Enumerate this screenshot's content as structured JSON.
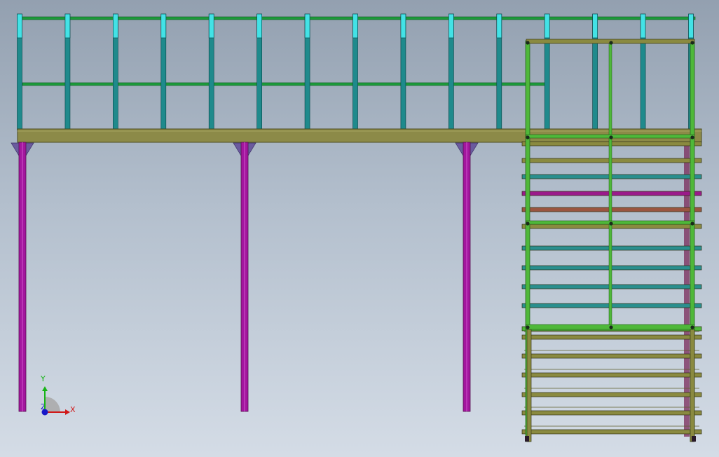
{
  "viewport": {
    "background_top": "#93a0b0",
    "background_bottom": "#d4dce6"
  },
  "model": {
    "railing_post_count": 15,
    "support_column_count": 3,
    "stair_tread_count": 21
  },
  "triad": {
    "x_label": "X",
    "y_label": "Y",
    "z_label": "Z"
  },
  "colors": {
    "deck": "#8c8a48",
    "deck_edge": "#4d4b1c",
    "post": "#1f8a8c",
    "post_cap": "#43e2e6",
    "rail": "#1c9a3a",
    "column": "#a3169e",
    "bracket": "#6a5a9e",
    "stair_frame": "#4fb83a",
    "stair_olive": "#8a8a40",
    "stair_teal": "#2a8f8e",
    "stair_magenta": "#9a1a8a",
    "stair_rust": "#9a5540",
    "axis_x": "#d01818",
    "axis_y": "#18b418",
    "axis_z": "#1818c8"
  }
}
